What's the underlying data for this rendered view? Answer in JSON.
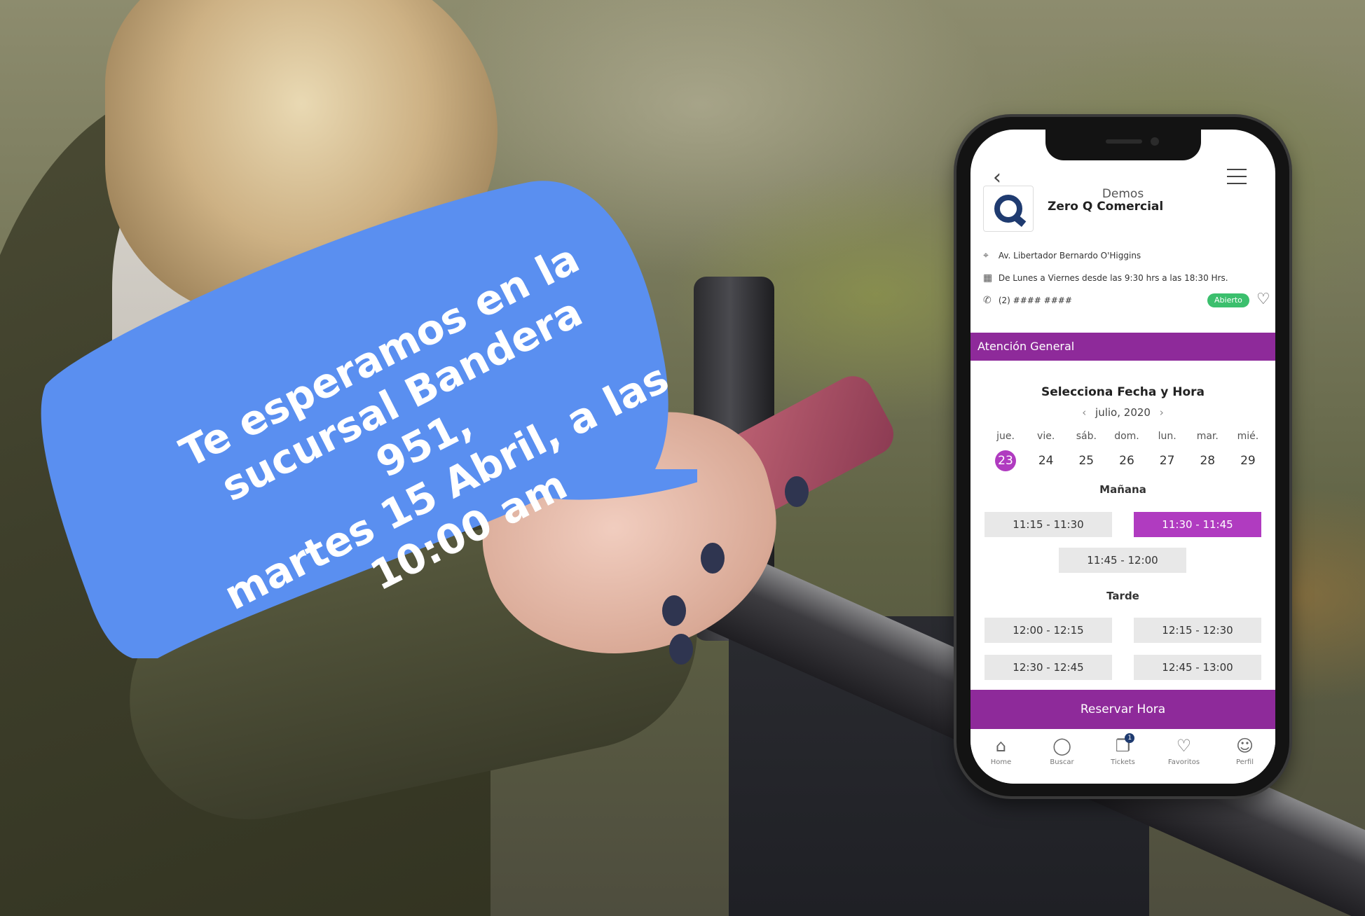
{
  "bubble": {
    "lines": [
      "Te esperamos en la",
      "sucursal Bandera 951,",
      "martes 15 Abril, a las",
      "10:00 am"
    ],
    "color": "#5a8ff0"
  },
  "app": {
    "top_title": "Demos",
    "business_name": "Zero Q Comercial",
    "address": "Av. Libertador Bernardo O'Higgins",
    "hours": "De Lunes a Viernes desde las 9:30 hrs a las 18:30 Hrs.",
    "phone": "(2) #### ####",
    "status_badge": "Abierto",
    "section": "Atención General",
    "select_title": "Selecciona Fecha y Hora",
    "month": "julio, 2020",
    "days": [
      {
        "name": "jue.",
        "num": "23",
        "selected": true
      },
      {
        "name": "vie.",
        "num": "24"
      },
      {
        "name": "sáb.",
        "num": "25"
      },
      {
        "name": "dom.",
        "num": "26"
      },
      {
        "name": "lun.",
        "num": "27"
      },
      {
        "name": "mar.",
        "num": "28"
      },
      {
        "name": "mié.",
        "num": "29"
      }
    ],
    "morning_label": "Mañana",
    "afternoon_label": "Tarde",
    "slots_morning": [
      "11:15 - 11:30",
      "11:30 - 11:45",
      "11:45 - 12:00"
    ],
    "slots_afternoon": [
      "12:00 - 12:15",
      "12:15 - 12:30",
      "12:30 - 12:45",
      "12:45 - 13:00"
    ],
    "selected_slot": "11:30 - 11:45",
    "reserve_button": "Reservar Hora",
    "tabs": [
      {
        "label": "Home",
        "icon": "home-icon"
      },
      {
        "label": "Buscar",
        "icon": "search-icon"
      },
      {
        "label": "Tickets",
        "icon": "tickets-icon",
        "badge": "1"
      },
      {
        "label": "Favoritos",
        "icon": "heart-icon"
      },
      {
        "label": "Perfil",
        "icon": "user-icon"
      }
    ],
    "accent_color": "#8e2a9a",
    "open_color": "#3bbf6d"
  }
}
